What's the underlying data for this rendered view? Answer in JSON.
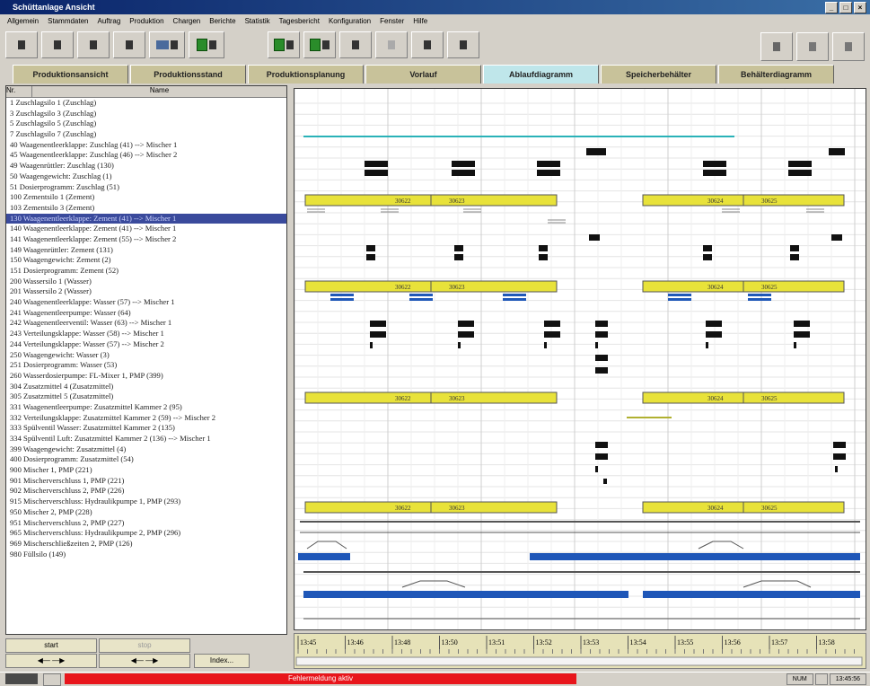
{
  "window": {
    "title": "Schüttanlage Ansicht"
  },
  "menu": [
    "Allgemein",
    "Stammdaten",
    "Auftrag",
    "Produktion",
    "Chargen",
    "Berichte",
    "Statistik",
    "Tagesbericht",
    "Konfiguration",
    "Fenster",
    "Hilfe"
  ],
  "tabs": [
    {
      "label": "Produktionsansicht",
      "active": false
    },
    {
      "label": "Produktionsstand",
      "active": false
    },
    {
      "label": "Produktionsplanung",
      "active": false
    },
    {
      "label": "Vorlauf",
      "active": false
    },
    {
      "label": "Ablaufdiagramm",
      "active": true
    },
    {
      "label": "Speicherbehälter",
      "active": false
    },
    {
      "label": "Behälterdiagramm",
      "active": false
    }
  ],
  "list": {
    "col_nr": "Nr.",
    "col_name": "Name",
    "rows": [
      "1  Zuschlagsilo 1 (Zuschlag)",
      "3  Zuschlagsilo 3 (Zuschlag)",
      "5  Zuschlagsilo 5 (Zuschlag)",
      "7  Zuschlagsilo 7 (Zuschlag)",
      "40  Waagenentleerklappe: Zuschlag (41) --> Mischer 1",
      "45  Waagenentleerklappe: Zuschlag (46) --> Mischer 2",
      "49  Waagenrüttler: Zuschlag (130)",
      "50  Waagengewicht: Zuschlag (1)",
      "51  Dosierprogramm: Zuschlag (51)",
      "100  Zementsilo 1 (Zement)",
      "103  Zementsilo 3 (Zement)",
      "140  Waagenentleerklappe: Zement (41) --> Mischer 1",
      "141  Waagenentleerklappe: Zement (55) --> Mischer 2",
      "149  Waagenrüttler: Zement (131)",
      "150  Waagengewicht: Zement (2)",
      "151  Dosierprogramm: Zement (52)",
      "200  Wassersilo 1 (Wasser)",
      "201  Wassersilo 2 (Wasser)",
      "240  Waagenentleerklappe: Wasser (57) --> Mischer 1",
      "241  Waagenentleerpumpe: Wasser (64)",
      "242  Waagenentleerventil: Wasser (63) --> Mischer 1",
      "243  Verteilungsklappe: Wasser (58) --> Mischer 1",
      "244  Verteilungsklappe: Wasser (57) --> Mischer 2",
      "250  Waagengewicht: Wasser (3)",
      "251  Dosierprogramm: Wasser (53)",
      "260  Wasserdosierpumpe: FL-Mixer 1, PMP (399)",
      "304  Zusatzmittel 4 (Zusatzmittel)",
      "305  Zusatzmittel 5 (Zusatzmittel)",
      "331  Waagenentleerpumpe: Zusatzmittel Kammer 2 (95)",
      "332  Verteilungsklappe: Zusatzmittel Kammer 2 (59) --> Mischer 2",
      "333  Spülventil Wasser: Zusatzmittel Kammer 2 (135)",
      "334  Spülventil Luft: Zusatzmittel Kammer 2 (136) --> Mischer 1",
      "399  Waagengewicht: Zusatzmittel (4)",
      "400  Dosierprogramm: Zusatzmittel (54)",
      "900  Mischer 1, PMP (221)",
      "901  Mischerverschluss 1, PMP (221)",
      "902  Mischerverschluss 2, PMP (226)",
      "915  Mischerverschluss: Hydraulikpumpe 1, PMP (293)",
      "950  Mischer 2, PMP (228)",
      "951  Mischerverschluss 2, PMP (227)",
      "965  Mischerverschluss: Hydraulikpumpe 2, PMP (296)",
      "969  Mischerschließzeiten 2, PMP (126)",
      "980  Füllsilo (149)"
    ],
    "selected_row_label": "130  Waagenentleerklappe: Zement (41) --> Mischer 1"
  },
  "footer": {
    "start_label": "start",
    "stop_label": "stop",
    "arrows_left": "◀— —▶",
    "arrows_right": "◀— —▶",
    "index_label": "Index..."
  },
  "time_axis": [
    "13:45",
    "13:46",
    "13:48",
    "13:50",
    "13:51",
    "13:52",
    "13:53",
    "13:54",
    "13:55",
    "13:56",
    "13:57",
    "13:58"
  ],
  "batch_labels": [
    "30622",
    "30623",
    "30624",
    "30625"
  ],
  "statusbar": {
    "red_message": "Fehlermeldung aktiv",
    "cells": [
      "NUM",
      "",
      "13:45:56"
    ]
  },
  "colors": {
    "yellow": "#e8e23a",
    "blue": "#1f57b8",
    "teal": "#2ab2b8",
    "selected": "#3a4a9c",
    "red": "#e8151b"
  }
}
